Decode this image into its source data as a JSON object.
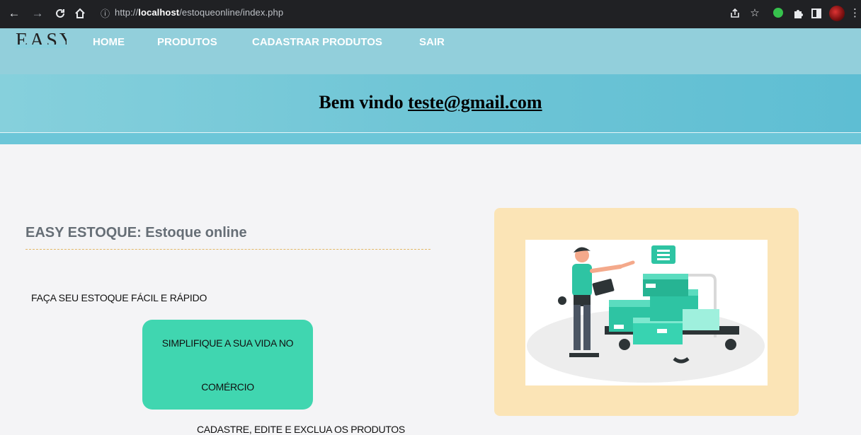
{
  "browser": {
    "url_prefix": "http://",
    "url_host": "localhost",
    "url_path": "/estoqueonline/index.php"
  },
  "header": {
    "logo_text": "EASY",
    "menu": [
      {
        "label": "HOME"
      },
      {
        "label": "PRODUTOS"
      },
      {
        "label": "CADASTRAR PRODUTOS"
      },
      {
        "label": "SAIR"
      }
    ],
    "welcome_prefix": "Bem vindo ",
    "welcome_email": "teste@gmail.com"
  },
  "main": {
    "title": "EASY ESTOQUE: Estoque online",
    "tagline": "FAÇA SEU ESTOQUE FÁCIL E RÁPIDO",
    "cta_line1": "SIMPLIFIQUE A SUA VIDA NO",
    "cta_line2": "COMÉRCIO",
    "bottom_text": "CADASTRE, EDITE E EXCLUA OS PRODUTOS"
  },
  "icons": {
    "back": "arrow-left-icon",
    "forward": "arrow-right-icon",
    "reload": "reload-icon",
    "home": "home-icon",
    "info": "info-icon",
    "share": "share-icon",
    "bookmark": "star-icon",
    "extension": "puzzle-icon",
    "sidebar": "sidebar-icon",
    "menu": "kebab-menu-icon"
  },
  "colors": {
    "nav_bg": "#92cfdb",
    "welcome_bg": "#6fc5d6",
    "cta_bg": "#40d6b0",
    "image_frame": "#fbe4b6",
    "title_color": "#666e76"
  }
}
